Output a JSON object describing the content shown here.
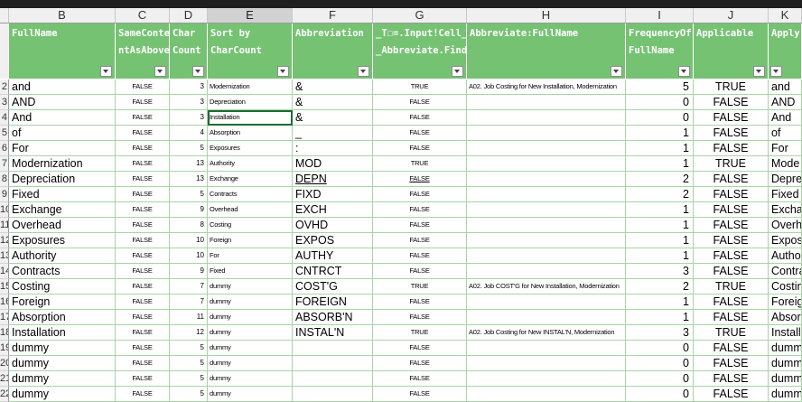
{
  "columns": [
    "B",
    "C",
    "D",
    "E",
    "F",
    "G",
    "H",
    "I",
    "J",
    "K"
  ],
  "selected_column": "E",
  "headers": {
    "B": "FullName",
    "C": "SameConte\nntAsAbove",
    "D": "Char\nCount",
    "E": "Sort by\nCharCount",
    "F": "Abbreviation",
    "G": "_T☐=.Input!Cell_To\n_Abbreviate.Find",
    "H": "Abbreviate:FullName",
    "I": "FrequencyOf:\nFullName",
    "J": "Applicable",
    "K": "Apply"
  },
  "rows": [
    {
      "rn": "2",
      "B": "and",
      "C": "FALSE",
      "D": "3",
      "E": "Modernization",
      "F": "&",
      "G": "TRUE",
      "H": "A02. Job Costing for New Installation, Modernization",
      "I": "5",
      "J": "TRUE",
      "K": "and"
    },
    {
      "rn": "3",
      "B": "AND",
      "C": "FALSE",
      "D": "3",
      "E": "Depreciation",
      "F": "&",
      "G": "FALSE",
      "H": "",
      "I": "0",
      "J": "FALSE",
      "K": "AND"
    },
    {
      "rn": "4",
      "B": "And",
      "C": "FALSE",
      "D": "3",
      "E": "Installation",
      "F": "&",
      "G": "FALSE",
      "H": "",
      "I": "0",
      "J": "FALSE",
      "K": "And"
    },
    {
      "rn": "5",
      "B": " of",
      "C": "FALSE",
      "D": "4",
      "E": "Absorption",
      "F": "_",
      "G": "FALSE",
      "H": "",
      "I": "1",
      "J": "FALSE",
      "K": " of"
    },
    {
      "rn": "6",
      "B": " For",
      "C": "FALSE",
      "D": "5",
      "E": "Exposures",
      "F": ":",
      "G": "FALSE",
      "H": "",
      "I": "1",
      "J": "FALSE",
      "K": " For"
    },
    {
      "rn": "7",
      "B": "Modernization",
      "C": "FALSE",
      "D": "13",
      "E": "Authority",
      "F": "MOD",
      "G": "TRUE",
      "H": "",
      "I": "1",
      "J": "TRUE",
      "K": "Mode"
    },
    {
      "rn": "8",
      "B": "Depreciation",
      "C": "FALSE",
      "D": "13",
      "E": "Exchange",
      "F": "DEPN",
      "G": "FALSE",
      "H": "",
      "I": "2",
      "J": "FALSE",
      "K": "Depre"
    },
    {
      "rn": "9",
      "B": "Fixed",
      "C": "FALSE",
      "D": "5",
      "E": "Contracts",
      "F": "FIXD",
      "G": "FALSE",
      "H": "",
      "I": "2",
      "J": "FALSE",
      "K": "Fixed"
    },
    {
      "rn": "10",
      "B": "Exchange",
      "C": "FALSE",
      "D": "9",
      "E": "Overhead",
      "F": "EXCH",
      "G": "FALSE",
      "H": "",
      "I": "1",
      "J": "FALSE",
      "K": "Excha"
    },
    {
      "rn": "11",
      "B": "Overhead",
      "C": "FALSE",
      "D": "8",
      "E": "Costing",
      "F": "OVHD",
      "G": "FALSE",
      "H": "",
      "I": "1",
      "J": "FALSE",
      "K": "Overh"
    },
    {
      "rn": "12",
      "B": "Exposures",
      "C": "FALSE",
      "D": "10",
      "E": "Foreign",
      "F": "EXPOS",
      "G": "FALSE",
      "H": "",
      "I": "1",
      "J": "FALSE",
      "K": "Expos"
    },
    {
      "rn": "13",
      "B": "Authority",
      "C": "FALSE",
      "D": "10",
      "E": "For",
      "F": "AUTHY",
      "G": "FALSE",
      "H": "",
      "I": "1",
      "J": "FALSE",
      "K": "Autho"
    },
    {
      "rn": "14",
      "B": "Contracts",
      "C": "FALSE",
      "D": "9",
      "E": "Fixed",
      "F": "CNTRCT",
      "G": "FALSE",
      "H": "",
      "I": "3",
      "J": "FALSE",
      "K": "Contra"
    },
    {
      "rn": "15",
      "B": "Costing",
      "C": "FALSE",
      "D": "7",
      "E": "dummy",
      "F": "COST'G",
      "G": "TRUE",
      "H": "A02. Job COST'G for New Installation, Modernization",
      "I": "2",
      "J": "TRUE",
      "K": "Costin"
    },
    {
      "rn": "16",
      "B": "Foreign",
      "C": "FALSE",
      "D": "7",
      "E": "dummy",
      "F": "FOREIGN",
      "G": "FALSE",
      "H": "",
      "I": "1",
      "J": "FALSE",
      "K": "Foreig"
    },
    {
      "rn": "17",
      "B": "Absorption",
      "C": "FALSE",
      "D": "11",
      "E": "dummy",
      "F": "ABSORB'N",
      "G": "FALSE",
      "H": "",
      "I": "1",
      "J": "FALSE",
      "K": "Absor"
    },
    {
      "rn": "18",
      "B": "Installation",
      "C": "FALSE",
      "D": "12",
      "E": "dummy",
      "F": "INSTAL'N",
      "G": "TRUE",
      "H": "A02. Job Costing for New INSTAL'N, Modernization",
      "I": "3",
      "J": "TRUE",
      "K": "Install"
    },
    {
      "rn": "19",
      "B": "dummy",
      "C": "FALSE",
      "D": "5",
      "E": "dummy",
      "F": "",
      "G": "FALSE",
      "H": "",
      "I": "0",
      "J": "FALSE",
      "K": "dumm"
    },
    {
      "rn": "20",
      "B": "dummy",
      "C": "FALSE",
      "D": "5",
      "E": "dummy",
      "F": "",
      "G": "FALSE",
      "H": "",
      "I": "0",
      "J": "FALSE",
      "K": "dumm"
    },
    {
      "rn": "21",
      "B": "dummy",
      "C": "FALSE",
      "D": "5",
      "E": "dummy",
      "F": "",
      "G": "FALSE",
      "H": "",
      "I": "0",
      "J": "FALSE",
      "K": "dumm"
    },
    {
      "rn": "22",
      "B": "dummy",
      "C": "FALSE",
      "D": "5",
      "E": "dummy",
      "F": "",
      "G": "FALSE",
      "H": "",
      "I": "0",
      "J": "FALSE",
      "K": "dumm"
    }
  ],
  "colors": {
    "header_green": "#75c273",
    "grid_green": "#a8d4a5",
    "selection": "#1d6b34"
  }
}
